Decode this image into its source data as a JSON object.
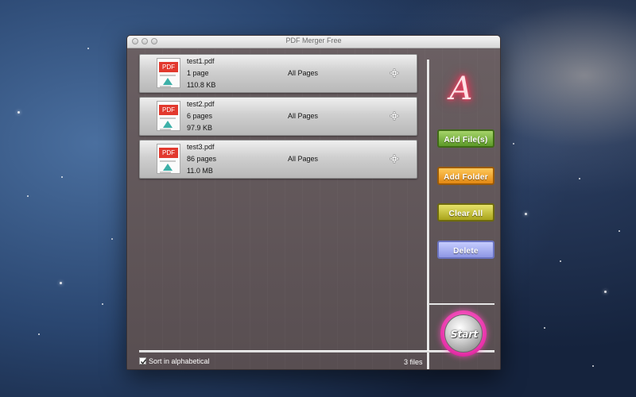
{
  "window": {
    "title": "PDF Merger Free"
  },
  "files": [
    {
      "name": "test1.pdf",
      "pages": "1 page",
      "size": "110.8 KB",
      "range": "All Pages",
      "icon": "pdf-file-icon",
      "badge": "PDF"
    },
    {
      "name": "test2.pdf",
      "pages": "6 pages",
      "size": "97.9 KB",
      "range": "All Pages",
      "icon": "pdf-file-icon",
      "badge": "PDF"
    },
    {
      "name": "test3.pdf",
      "pages": "86 pages",
      "size": "11.0 MB",
      "range": "All Pages",
      "icon": "pdf-file-icon",
      "badge": "PDF"
    }
  ],
  "sidebar": {
    "logo_letter": "A",
    "add_files_label": "Add File(s)",
    "add_folder_label": "Add Folder",
    "clear_all_label": "Clear All",
    "delete_label": "Delete",
    "start_label": "Start"
  },
  "footer": {
    "sort_label": "Sort in alphabetical",
    "sort_checked": true,
    "file_count": "3 files"
  },
  "colors": {
    "window_bg": "#5f5558",
    "add_files": "#5c9a27",
    "add_folder": "#e38812",
    "clear_all": "#a9a41b",
    "delete": "#8e97e4",
    "start_ring": "#e72fa8",
    "logo_glow": "#ff2b55",
    "pdf_badge": "#e2392e"
  }
}
